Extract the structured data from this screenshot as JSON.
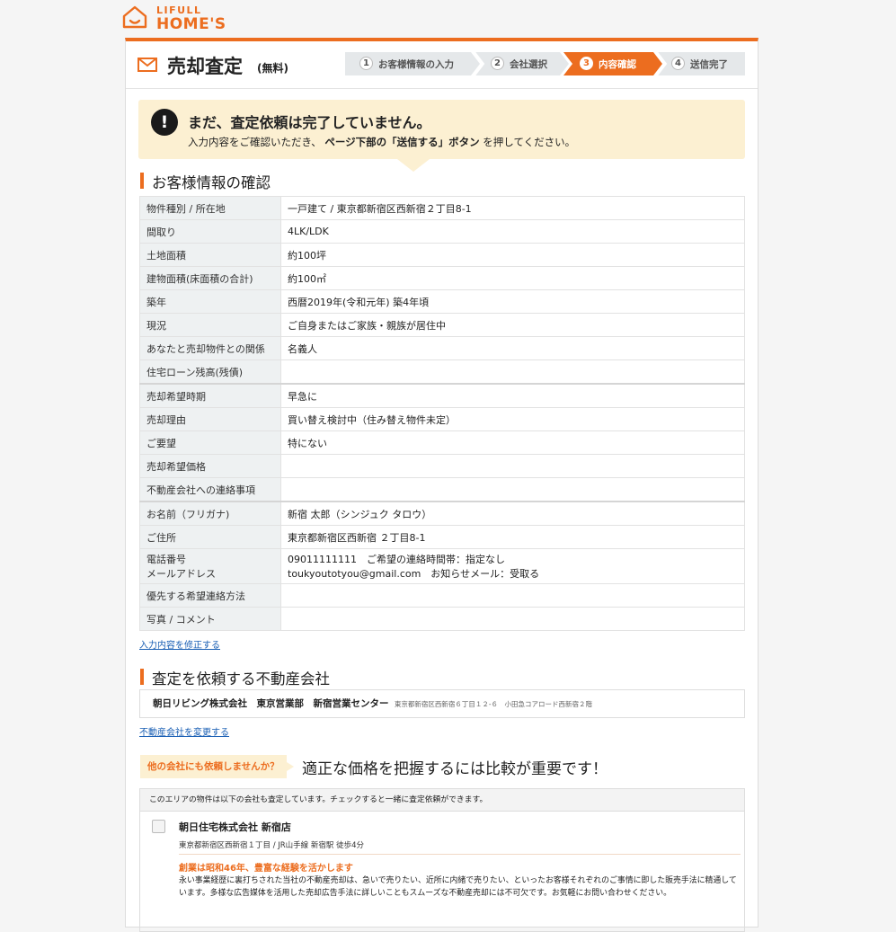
{
  "logo": {
    "top": "LIFULL",
    "bottom": "HOME'S"
  },
  "header": {
    "title": "売却査定",
    "sub": "(無料)"
  },
  "steps": [
    {
      "num": "1",
      "label": "お客様情報の入力",
      "active": false
    },
    {
      "num": "2",
      "label": "会社選択",
      "active": false
    },
    {
      "num": "3",
      "label": "内容確認",
      "active": true
    },
    {
      "num": "4",
      "label": "送信完了",
      "active": false
    }
  ],
  "alert": {
    "heading": "まだ、査定依頼は完了していません。",
    "text_before": "入力内容をご確認いただき、",
    "text_bold": "ページ下部の「送信する」ボタン",
    "text_after": "を押してください。"
  },
  "section1_title": "お客様情報の確認",
  "info": [
    {
      "label": "物件種別 / 所在地",
      "value": "一戸建て / 東京都新宿区西新宿２丁目8-1"
    },
    {
      "label": "間取り",
      "value": "4LK/LDK"
    },
    {
      "label": "土地面積",
      "value": "約100坪"
    },
    {
      "label": "建物面積(床面積の合計)",
      "value": "約100㎡"
    },
    {
      "label": "築年",
      "value": "西暦2019年(令和元年) 築4年頃"
    },
    {
      "label": "現況",
      "value": "ご自身またはご家族・親族が居住中"
    },
    {
      "label": "あなたと売却物件との関係",
      "value": "名義人"
    },
    {
      "label": "住宅ローン残高(残債)",
      "value": ""
    },
    {
      "label": "売却希望時期",
      "value": "早急に"
    },
    {
      "label": "売却理由",
      "value": "買い替え検討中（住み替え物件未定）"
    },
    {
      "label": "ご要望",
      "value": "特にない"
    },
    {
      "label": "売却希望価格",
      "value": ""
    },
    {
      "label": "不動産会社への連絡事項",
      "value": ""
    },
    {
      "label": "お名前（フリガナ)",
      "value": "新宿 太郎（シンジュク タロウ）"
    },
    {
      "label": "ご住所",
      "value": "東京都新宿区西新宿 ２丁目8-1"
    },
    {
      "label": "電話番号",
      "label2": "メールアドレス",
      "value": "09011111111　ご希望の連絡時間帯：指定なし",
      "value2": "toukyoutotyou@gmail.com　お知らせメール：受取る"
    },
    {
      "label": "優先する希望連絡方法",
      "value": ""
    },
    {
      "label": "写真 / コメント",
      "value": ""
    }
  ],
  "edit_link": "入力内容を修正する",
  "section2_title": "査定を依頼する不動産会社",
  "company": {
    "name": "朝日リビング株式会社　東京営業部　新宿営業センター",
    "address": "東京都新宿区西新宿６丁目１２-６　小田急コアロード西新宿２階"
  },
  "change_link": "不動産会社を変更する",
  "other": {
    "badge": "他の会社にも依頼しませんか？",
    "heading": "適正な価格を把握するには比較が重要です！",
    "list_head": "このエリアの物件は以下の会社も査定しています。チェックすると一緒に査定依頼ができます。",
    "item": {
      "name": "朝日住宅株式会社 新宿店",
      "address": "東京都新宿区西新宿１丁目 / JR山手線 新宿駅 徒歩4分",
      "tagline": "創業は昭和46年、豊富な経験を活かします",
      "desc": "永い事業経歴に裏打ちされた当社の不動産売却は、急いで売りたい、近所に内緒で売りたい、といったお客様それぞれのご事情に即した販売手法に精通しています。多様な広告媒体を活用した売却広告手法に詳しいこともスムーズな不動産売却には不可欠です。お気軽にお問い合わせください。"
    }
  },
  "colors": {
    "accent": "#ec6d1f",
    "alert_bg": "#fcf0d2",
    "link": "#1a5fb4"
  }
}
